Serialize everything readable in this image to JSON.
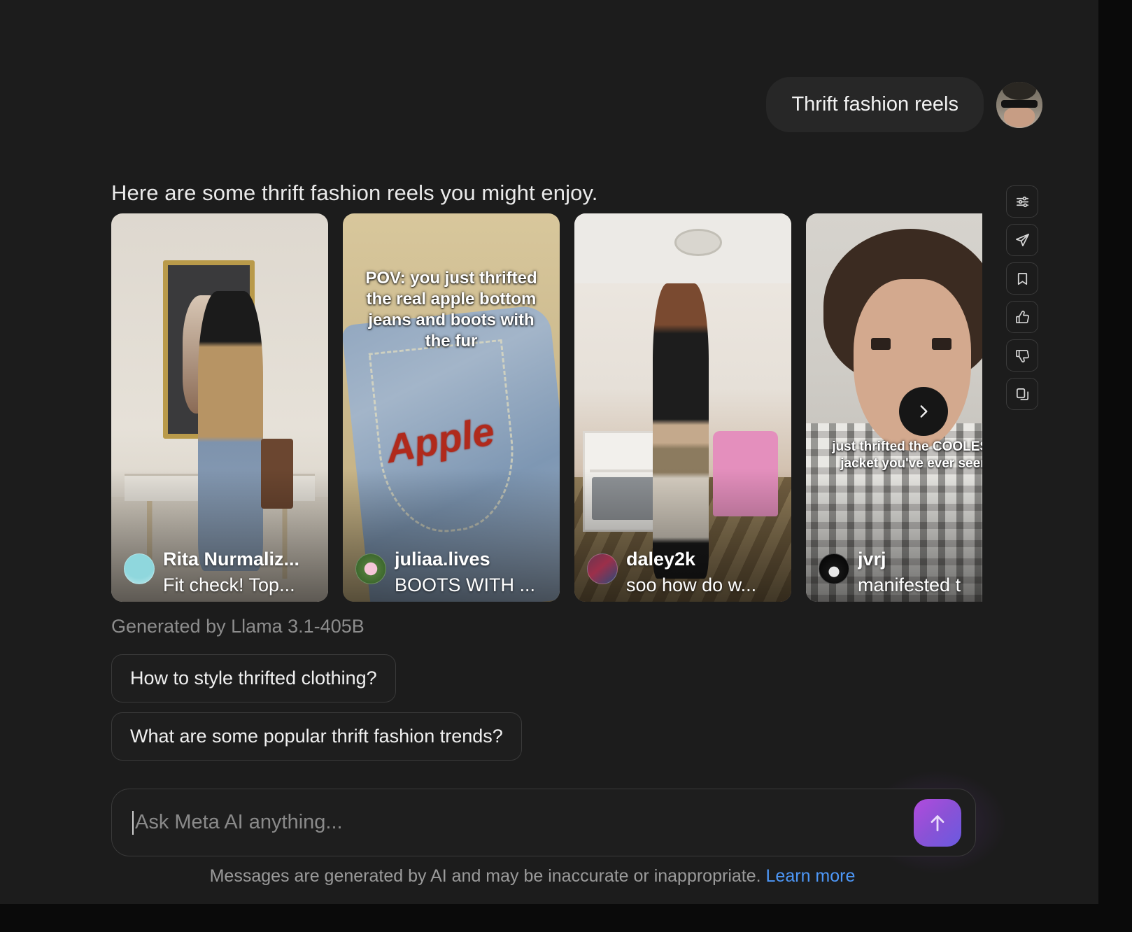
{
  "conversation": {
    "user_message": "Thrift fashion reels",
    "assistant_intro": "Here are some thrift fashion reels you might enjoy.",
    "generated_by": "Generated by Llama 3.1-405B"
  },
  "reels": [
    {
      "handle": "Rita Nurmaliz...",
      "caption": "Fit check! Top...",
      "overlay_text": ""
    },
    {
      "handle": "juliaa.lives",
      "caption": "BOOTS WITH ...",
      "overlay_text": "POV: you just thrifted the real apple bottom jeans and boots with the fur",
      "stitch_text": "Apple"
    },
    {
      "handle": "daley2k",
      "caption": "soo how do w...",
      "overlay_text": ""
    },
    {
      "handle": "jvrj",
      "caption": "manifested t",
      "overlay_text": "just thrifted the COOLEST jacket you've ever seen"
    }
  ],
  "carousel": {
    "next_label": "chevron-right"
  },
  "action_rail": [
    {
      "name": "tune-icon",
      "label": "Adjust response"
    },
    {
      "name": "send-icon",
      "label": "Share"
    },
    {
      "name": "bookmark-icon",
      "label": "Save"
    },
    {
      "name": "thumbs-up-icon",
      "label": "Good response"
    },
    {
      "name": "thumbs-down-icon",
      "label": "Bad response"
    },
    {
      "name": "copy-icon",
      "label": "Copy"
    }
  ],
  "suggestions": [
    "How to style thrifted clothing?",
    "What are some popular thrift fashion trends?"
  ],
  "composer": {
    "placeholder": "Ask Meta AI anything...",
    "value": "",
    "send_label": "send-arrow-icon"
  },
  "footer": {
    "disclaimer": "Messages are generated by AI and may be inaccurate or inappropriate.",
    "link": "Learn more"
  },
  "colors": {
    "page_background": "#0a0a0a",
    "panel_background": "#1c1c1c",
    "bubble_background": "#272727",
    "chip_border": "#3a3a3a",
    "link_blue": "#4d97f7",
    "send_gradient_start": "#b14bdd",
    "send_gradient_end": "#6a5ae0",
    "muted_text": "#8d8d8d"
  }
}
